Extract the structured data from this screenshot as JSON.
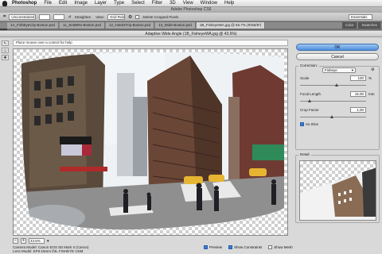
{
  "menubar": {
    "items": [
      "Photoshop",
      "File",
      "Edit",
      "Image",
      "Layer",
      "Type",
      "Select",
      "Filter",
      "3D",
      "View",
      "Window",
      "Help"
    ]
  },
  "app": {
    "title": "Adobe Photoshop CS6"
  },
  "options_bar": {
    "style_value": "Unconstrained",
    "straighten_label": "Straighten",
    "view_value": "Grid Rule",
    "delete_cropped_label": "Delete Cropped Pixels",
    "right_value": "Essentials"
  },
  "doc_tabs": [
    "1A_FishEyeCity-Boston.psd",
    "11_SmBIRe-Boston.psd",
    "12_Hotel4Trip-Boston.psd",
    "13_Wide-Boston.psd",
    "1B_FisheyeWA.jpg @ 66.7% (RGB/8*)"
  ],
  "right_tabs": [
    "Color",
    "Swatches"
  ],
  "dialog": {
    "title": "Adaptive Wide Angle (1B_FisheyeWA.jpg @ 43.6%)",
    "help_text": "Place mouse over a control for help",
    "zoom_value": "43.6%",
    "camera_model": "Camera Model: Canon EOS 5D Mark II (Canon)",
    "lens_model": "Lens Model: EF8-15mm f/4L FISHEYE USM",
    "preview_label": "Preview",
    "show_constraints_label": "Show Constraints",
    "show_mesh_label": "Show Mesh",
    "preview_checked": true,
    "show_constraints_checked": true,
    "show_mesh_checked": false
  },
  "panel": {
    "ok_label": "OK",
    "cancel_label": "Cancel",
    "correction_legend": "Correction:",
    "correction_value": "Fisheye",
    "scale_label": "Scale",
    "scale_value": "100",
    "scale_unit": "%",
    "focal_label": "Focal Length",
    "focal_value": "15.00",
    "focal_unit": "mm",
    "crop_label": "Crop Factor",
    "crop_value": "1.00",
    "as_shot_label": "As Shot",
    "as_shot_checked": true,
    "detail_legend": "Detail"
  }
}
